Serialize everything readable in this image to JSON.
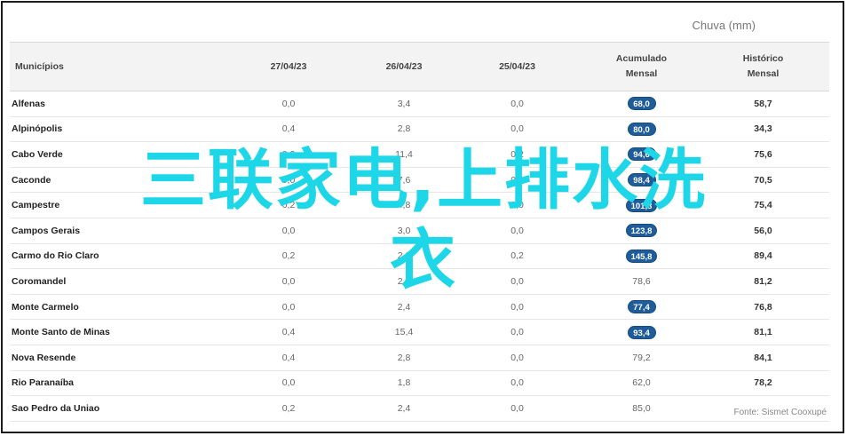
{
  "caption": "Chuva (mm)",
  "columns": {
    "municipio": "Municípios",
    "d1": "27/04/23",
    "d2": "26/04/23",
    "d3": "25/04/23",
    "acumulado_l1": "Acumulado",
    "acumulado_l2": "Mensal",
    "historico_l1": "Histórico",
    "historico_l2": "Mensal"
  },
  "rows": [
    {
      "municipio": "Alfenas",
      "d1": "0,0",
      "d2": "3,4",
      "d3": "0,0",
      "acumulado": "68,0",
      "highlight": true,
      "historico": "58,7"
    },
    {
      "municipio": "Alpinópolis",
      "d1": "0,4",
      "d2": "2,8",
      "d3": "0,0",
      "acumulado": "80,0",
      "highlight": true,
      "historico": "34,3"
    },
    {
      "municipio": "Cabo Verde",
      "d1": "0,2",
      "d2": "11,4",
      "d3": "0,2",
      "acumulado": "94,6",
      "highlight": true,
      "historico": "75,6"
    },
    {
      "municipio": "Caconde",
      "d1": "0,0",
      "d2": "7,6",
      "d3": "0,0",
      "acumulado": "98,4",
      "highlight": true,
      "historico": "70,5"
    },
    {
      "municipio": "Campestre",
      "d1": "0,2",
      "d2": "4,8",
      "d3": "0,0",
      "acumulado": "101,3",
      "highlight": true,
      "historico": "75,4"
    },
    {
      "municipio": "Campos Gerais",
      "d1": "0,0",
      "d2": "3,0",
      "d3": "0,0",
      "acumulado": "123,8",
      "highlight": true,
      "historico": "56,0"
    },
    {
      "municipio": "Carmo do Rio Claro",
      "d1": "0,2",
      "d2": "2,2",
      "d3": "0,2",
      "acumulado": "145,8",
      "highlight": true,
      "historico": "89,4"
    },
    {
      "municipio": "Coromandel",
      "d1": "0,0",
      "d2": "2,6",
      "d3": "0,0",
      "acumulado": "78,6",
      "highlight": false,
      "historico": "81,2"
    },
    {
      "municipio": "Monte Carmelo",
      "d1": "0,0",
      "d2": "2,4",
      "d3": "0,0",
      "acumulado": "77,4",
      "highlight": true,
      "historico": "76,8"
    },
    {
      "municipio": "Monte Santo de Minas",
      "d1": "0,4",
      "d2": "15,4",
      "d3": "0,0",
      "acumulado": "93,4",
      "highlight": true,
      "historico": "81,1"
    },
    {
      "municipio": "Nova Resende",
      "d1": "0,4",
      "d2": "2,8",
      "d3": "0,0",
      "acumulado": "79,2",
      "highlight": false,
      "historico": "84,1"
    },
    {
      "municipio": "Rio Paranaíba",
      "d1": "0,0",
      "d2": "1,8",
      "d3": "0,0",
      "acumulado": "62,0",
      "highlight": false,
      "historico": "78,2"
    },
    {
      "municipio": "Sao Pedro da Uniao",
      "d1": "0,2",
      "d2": "2,4",
      "d3": "0,0",
      "acumulado": "85,0",
      "highlight": false,
      "historico": ""
    }
  ],
  "source": "Fonte: Sismet Cooxupé",
  "overlay": {
    "line1": "三联家电,上排水洗",
    "line2": "衣"
  },
  "colors": {
    "pill": "#1e5d9a",
    "overlay": "#1dd6e8",
    "header_bg": "#f3f3f4"
  }
}
